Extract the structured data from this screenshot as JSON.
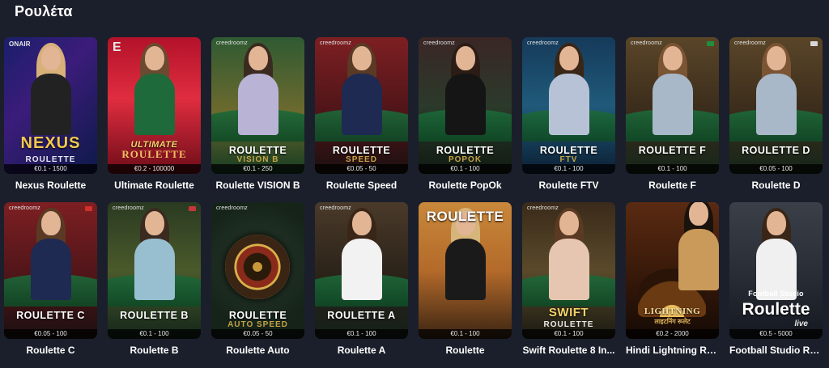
{
  "section": {
    "title": "Ρουλέτα"
  },
  "colors": {
    "background": "#1b1f2b",
    "gold": "#d9b14a"
  },
  "games": [
    {
      "name": "Nexus Roulette",
      "limit": "€0.1 - 1500",
      "brand": "ONAIR",
      "tile_title": "NEXUS",
      "tile_sub": "ROULETTE",
      "theme": "nexus"
    },
    {
      "name": "Ultimate Roulette",
      "limit": "€0.2 - 100000",
      "brand": "E",
      "tile_title": "ULTIMATE",
      "tile_sub": "ROULETTE",
      "theme": "ultimate"
    },
    {
      "name": "Roulette VISION B",
      "limit": "€0.1 - 250",
      "brand": "creedroomz",
      "tile_title": "ROULETTE",
      "tile_sub": "VISION B",
      "theme": "green"
    },
    {
      "name": "Roulette Speed",
      "limit": "€0.05 - 50",
      "brand": "creedroomz",
      "tile_title": "ROULETTE",
      "tile_sub": "SPEED",
      "theme": "red"
    },
    {
      "name": "Roulette PopOk",
      "limit": "€0.1 - 100",
      "brand": "creedroomz",
      "tile_title": "ROULETTE",
      "tile_sub": "POPOK",
      "theme": "popok"
    },
    {
      "name": "Roulette FTV",
      "limit": "€0.1 - 100",
      "brand": "creedroomz",
      "tile_title": "ROULETTE",
      "tile_sub": "FTV",
      "theme": "ftv"
    },
    {
      "name": "Roulette F",
      "limit": "€0.1 - 100",
      "brand": "creedroomz",
      "tile_title": "ROULETTE F",
      "tile_sub": "",
      "theme": "bar",
      "flag": "#1f8f3a"
    },
    {
      "name": "Roulette D",
      "limit": "€0.05 - 100",
      "brand": "creedroomz",
      "tile_title": "ROULETTE D",
      "tile_sub": "",
      "theme": "bar",
      "flag": "#d8d8d8"
    },
    {
      "name": "Roulette C",
      "limit": "€0.05 - 100",
      "brand": "creedroomz",
      "tile_title": "ROULETTE C",
      "tile_sub": "",
      "theme": "red",
      "flag": "#d0312d"
    },
    {
      "name": "Roulette B",
      "limit": "€0.1 - 100",
      "brand": "creedroomz",
      "tile_title": "ROULETTE B",
      "tile_sub": "",
      "theme": "plants",
      "flag": "#c7363a"
    },
    {
      "name": "Roulette Auto",
      "limit": "€0.05 - 50",
      "brand": "creedroomz",
      "tile_title": "ROULETTE",
      "tile_sub": "AUTO SPEED",
      "theme": "auto"
    },
    {
      "name": "Roulette A",
      "limit": "€0.1 - 100",
      "brand": "creedroomz",
      "tile_title": "ROULETTE A",
      "tile_sub": "",
      "theme": "classic"
    },
    {
      "name": "Roulette",
      "limit": "€0.1 - 100",
      "brand": "",
      "tile_title": "ROULETTE",
      "tile_sub": "",
      "theme": "gold"
    },
    {
      "name": "Swift Roulette 8 In...",
      "limit": "€0.1 - 100",
      "brand": "creedroomz",
      "tile_title": "SWIFT",
      "tile_sub": "ROULETTE",
      "theme": "swift"
    },
    {
      "name": "Hindi Lightning Ro...",
      "limit": "€0.2 - 2000",
      "brand": "",
      "tile_title": "LIGHTNING",
      "tile_sub": "लाइटनिंग रूलेट",
      "theme": "lightning"
    },
    {
      "name": "Football Studio Ro...",
      "limit": "€0.5 - 5000",
      "brand": "Football Studio",
      "tile_title": "Roulette",
      "tile_sub": "live",
      "theme": "football"
    }
  ]
}
